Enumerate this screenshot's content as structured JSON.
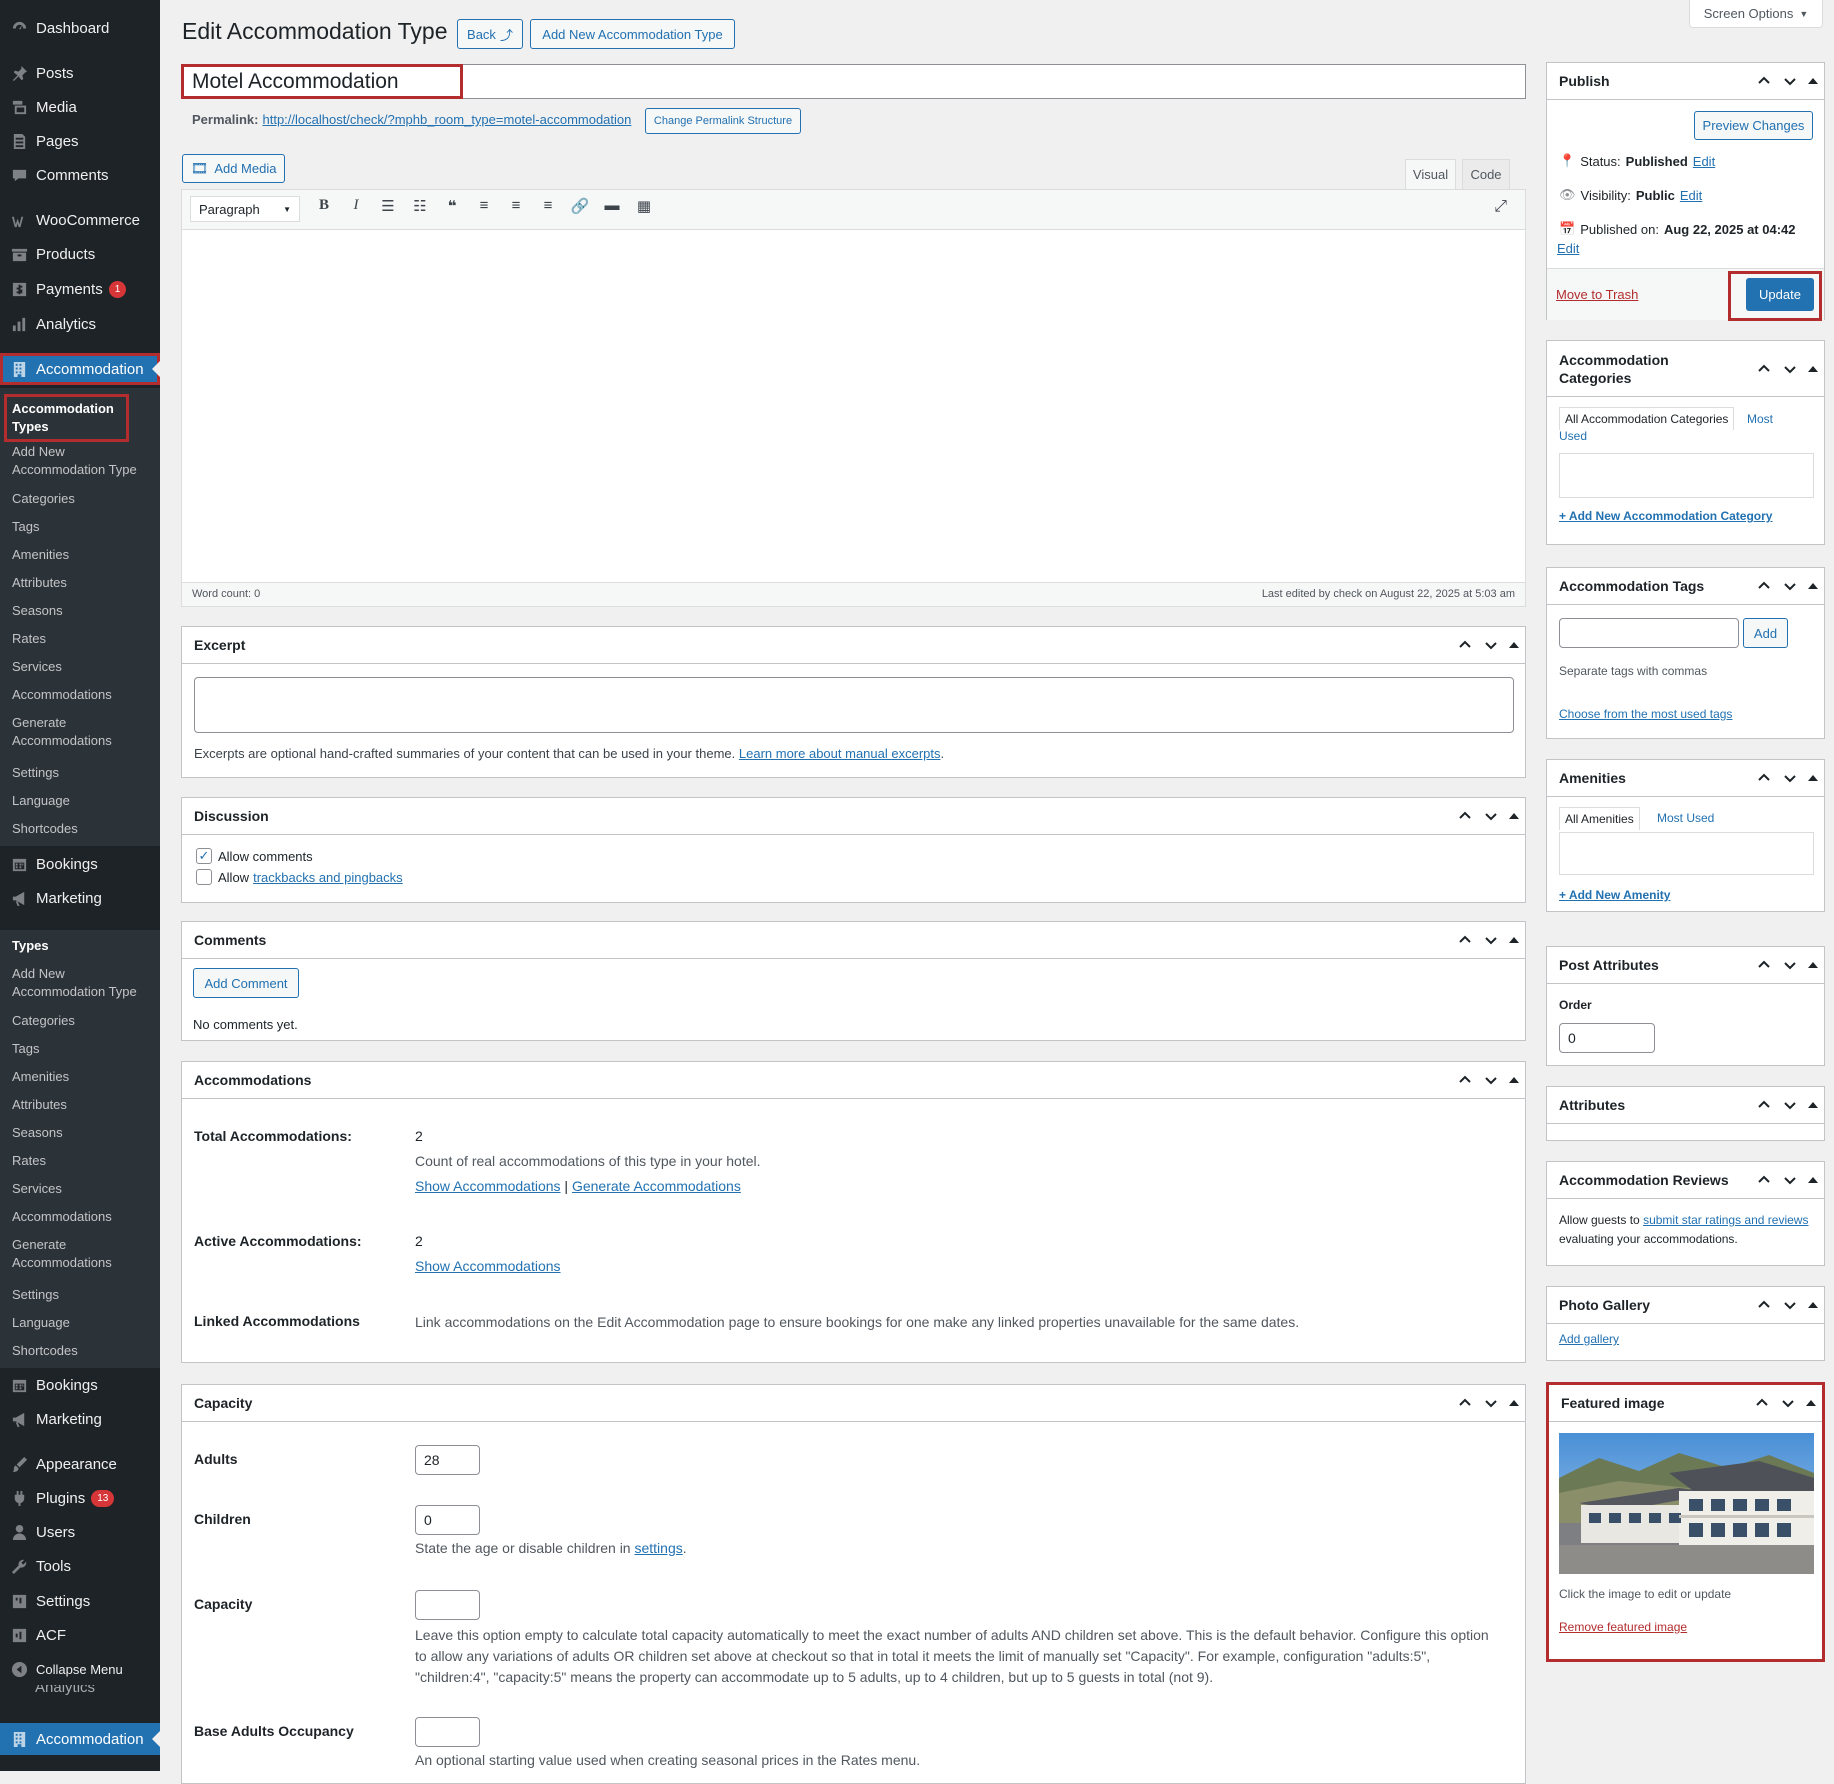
{
  "screen_options": "Screen Options",
  "sidebar": {
    "items": [
      {
        "label": "Dashboard",
        "icon": "dashboard-icon"
      },
      {
        "label": "Posts",
        "icon": "pin-icon"
      },
      {
        "label": "Media",
        "icon": "media-icon"
      },
      {
        "label": "Pages",
        "icon": "page-icon"
      },
      {
        "label": "Comments",
        "icon": "comment-icon"
      },
      {
        "label": "WooCommerce",
        "icon": "woocommerce-icon"
      },
      {
        "label": "Products",
        "icon": "archive-icon"
      },
      {
        "label": "Payments",
        "icon": "payments-icon",
        "badge": "1"
      },
      {
        "label": "Analytics",
        "icon": "bar-chart-icon"
      },
      {
        "label": "Accommodation",
        "icon": "building-icon"
      }
    ],
    "sub1": [
      "Accommodation Types",
      "Add New Accommodation Type",
      "Categories",
      "Tags",
      "Amenities",
      "Attributes",
      "Seasons",
      "Rates",
      "Services",
      "Accommodations",
      "Generate Accommodations",
      "Settings",
      "Language",
      "Shortcodes"
    ],
    "mid_items": [
      {
        "label": "Bookings",
        "icon": "calendar-icon"
      },
      {
        "label": "Marketing",
        "icon": "megaphone-icon"
      }
    ],
    "sub2": [
      "Types",
      "Add New Accommodation Type",
      "Categories",
      "Tags",
      "Amenities",
      "Attributes",
      "Seasons",
      "Rates",
      "Services",
      "Accommodations",
      "Generate Accommodations",
      "Settings",
      "Language",
      "Shortcodes"
    ],
    "bottom_items": [
      {
        "label": "Bookings",
        "icon": "calendar-icon"
      },
      {
        "label": "Marketing",
        "icon": "megaphone-icon"
      },
      {
        "label": "Appearance",
        "icon": "brush-icon"
      },
      {
        "label": "Plugins",
        "icon": "plug-icon",
        "badge": "13"
      },
      {
        "label": "Users",
        "icon": "user-icon"
      },
      {
        "label": "Tools",
        "icon": "wrench-icon"
      },
      {
        "label": "Settings",
        "icon": "sliders-icon"
      },
      {
        "label": "ACF",
        "icon": "acf-icon"
      },
      {
        "label": "Collapse Menu",
        "icon": "collapse-icon"
      }
    ],
    "partial_item": "Analytics",
    "last_item": "Accommodation"
  },
  "header": {
    "title": "Edit Accommodation Type",
    "back_label": "Back",
    "add_new_label": "Add New Accommodation Type"
  },
  "post": {
    "title": "Motel Accommodation",
    "permalink_label": "Permalink:",
    "permalink_url": "http://localhost/check/?mphb_room_type=motel-accommodation",
    "change_permalink": "Change Permalink Structure"
  },
  "editor": {
    "add_media": "Add Media",
    "tab_visual": "Visual",
    "tab_code": "Code",
    "format": "Paragraph",
    "word_count": "Word count: 0",
    "last_edited": "Last edited by check on August 22, 2025 at 5:03 am"
  },
  "excerpt": {
    "title": "Excerpt",
    "help": "Excerpts are optional hand-crafted summaries of your content that can be used in your theme.",
    "help_link": "Learn more about manual excerpts"
  },
  "discussion": {
    "title": "Discussion",
    "allow_comments": "Allow comments",
    "allow_prefix": "Allow",
    "trackbacks": "trackbacks and pingbacks"
  },
  "comments": {
    "title": "Comments",
    "add_comment": "Add Comment",
    "none": "No comments yet."
  },
  "accommodations": {
    "title": "Accommodations",
    "total_label": "Total Accommodations:",
    "total_value": "2",
    "total_desc": "Count of real accommodations of this type in your hotel.",
    "show_link": "Show Accommodations",
    "sep": "|",
    "generate_link": "Generate Accommodations",
    "active_label": "Active Accommodations:",
    "active_value": "2",
    "linked_label": "Linked Accommodations",
    "linked_desc": "Link accommodations on the Edit Accommodation page to ensure bookings for one make any linked properties unavailable for the same dates."
  },
  "capacity": {
    "title": "Capacity",
    "adults_label": "Adults",
    "adults_value": "28",
    "children_label": "Children",
    "children_value": "0",
    "children_desc": "State the age or disable children in",
    "children_link": "settings",
    "capacity_label": "Capacity",
    "capacity_desc": "Leave this option empty to calculate total capacity automatically to meet the exact number of adults AND children set above. This is the default behavior. Configure this option to allow any variations of adults OR children set above at checkout so that in total it meets the limit of manually set \"Capacity\". For example, configuration \"adults:5\", \"children:4\", \"capacity:5\" means the property can accommodate up to 5 adults, up to 4 children, but up to 5 guests in total (not 9).",
    "base_label": "Base Adults Occupancy",
    "base_desc": "An optional starting value used when creating seasonal prices in the Rates menu."
  },
  "publish": {
    "title": "Publish",
    "preview": "Preview Changes",
    "status_label": "Status:",
    "status_value": "Published",
    "visibility_label": "Visibility:",
    "visibility_value": "Public",
    "published_label": "Published on:",
    "published_value": "Aug 22, 2025 at 04:42",
    "edit": "Edit",
    "trash": "Move to Trash",
    "update": "Update"
  },
  "acc_categories": {
    "title": "Accommodation Categories",
    "tab_all": "All Accommodation Categories",
    "tab_most": "Most Used",
    "add_new": "+ Add New Accommodation Category"
  },
  "acc_tags": {
    "title": "Accommodation Tags",
    "add": "Add",
    "help": "Separate tags with commas",
    "choose": "Choose from the most used tags"
  },
  "amenities": {
    "title": "Amenities",
    "tab_all": "All Amenities",
    "tab_most": "Most Used",
    "add_new": "+ Add New Amenity"
  },
  "post_attributes": {
    "title": "Post Attributes",
    "order_label": "Order",
    "order_value": "0"
  },
  "attributes": {
    "title": "Attributes"
  },
  "reviews": {
    "title": "Accommodation Reviews",
    "text_pre": "Allow guests to",
    "link": "submit star ratings and reviews",
    "text_post": "evaluating your accommodations."
  },
  "gallery": {
    "title": "Photo Gallery",
    "add": "Add gallery"
  },
  "featured": {
    "title": "Featured image",
    "help": "Click the image to edit or update",
    "remove": "Remove featured image"
  },
  "colors": {
    "accent": "#2271b1",
    "highlight": "#b32d2e",
    "sidebar": "#1d2327"
  }
}
